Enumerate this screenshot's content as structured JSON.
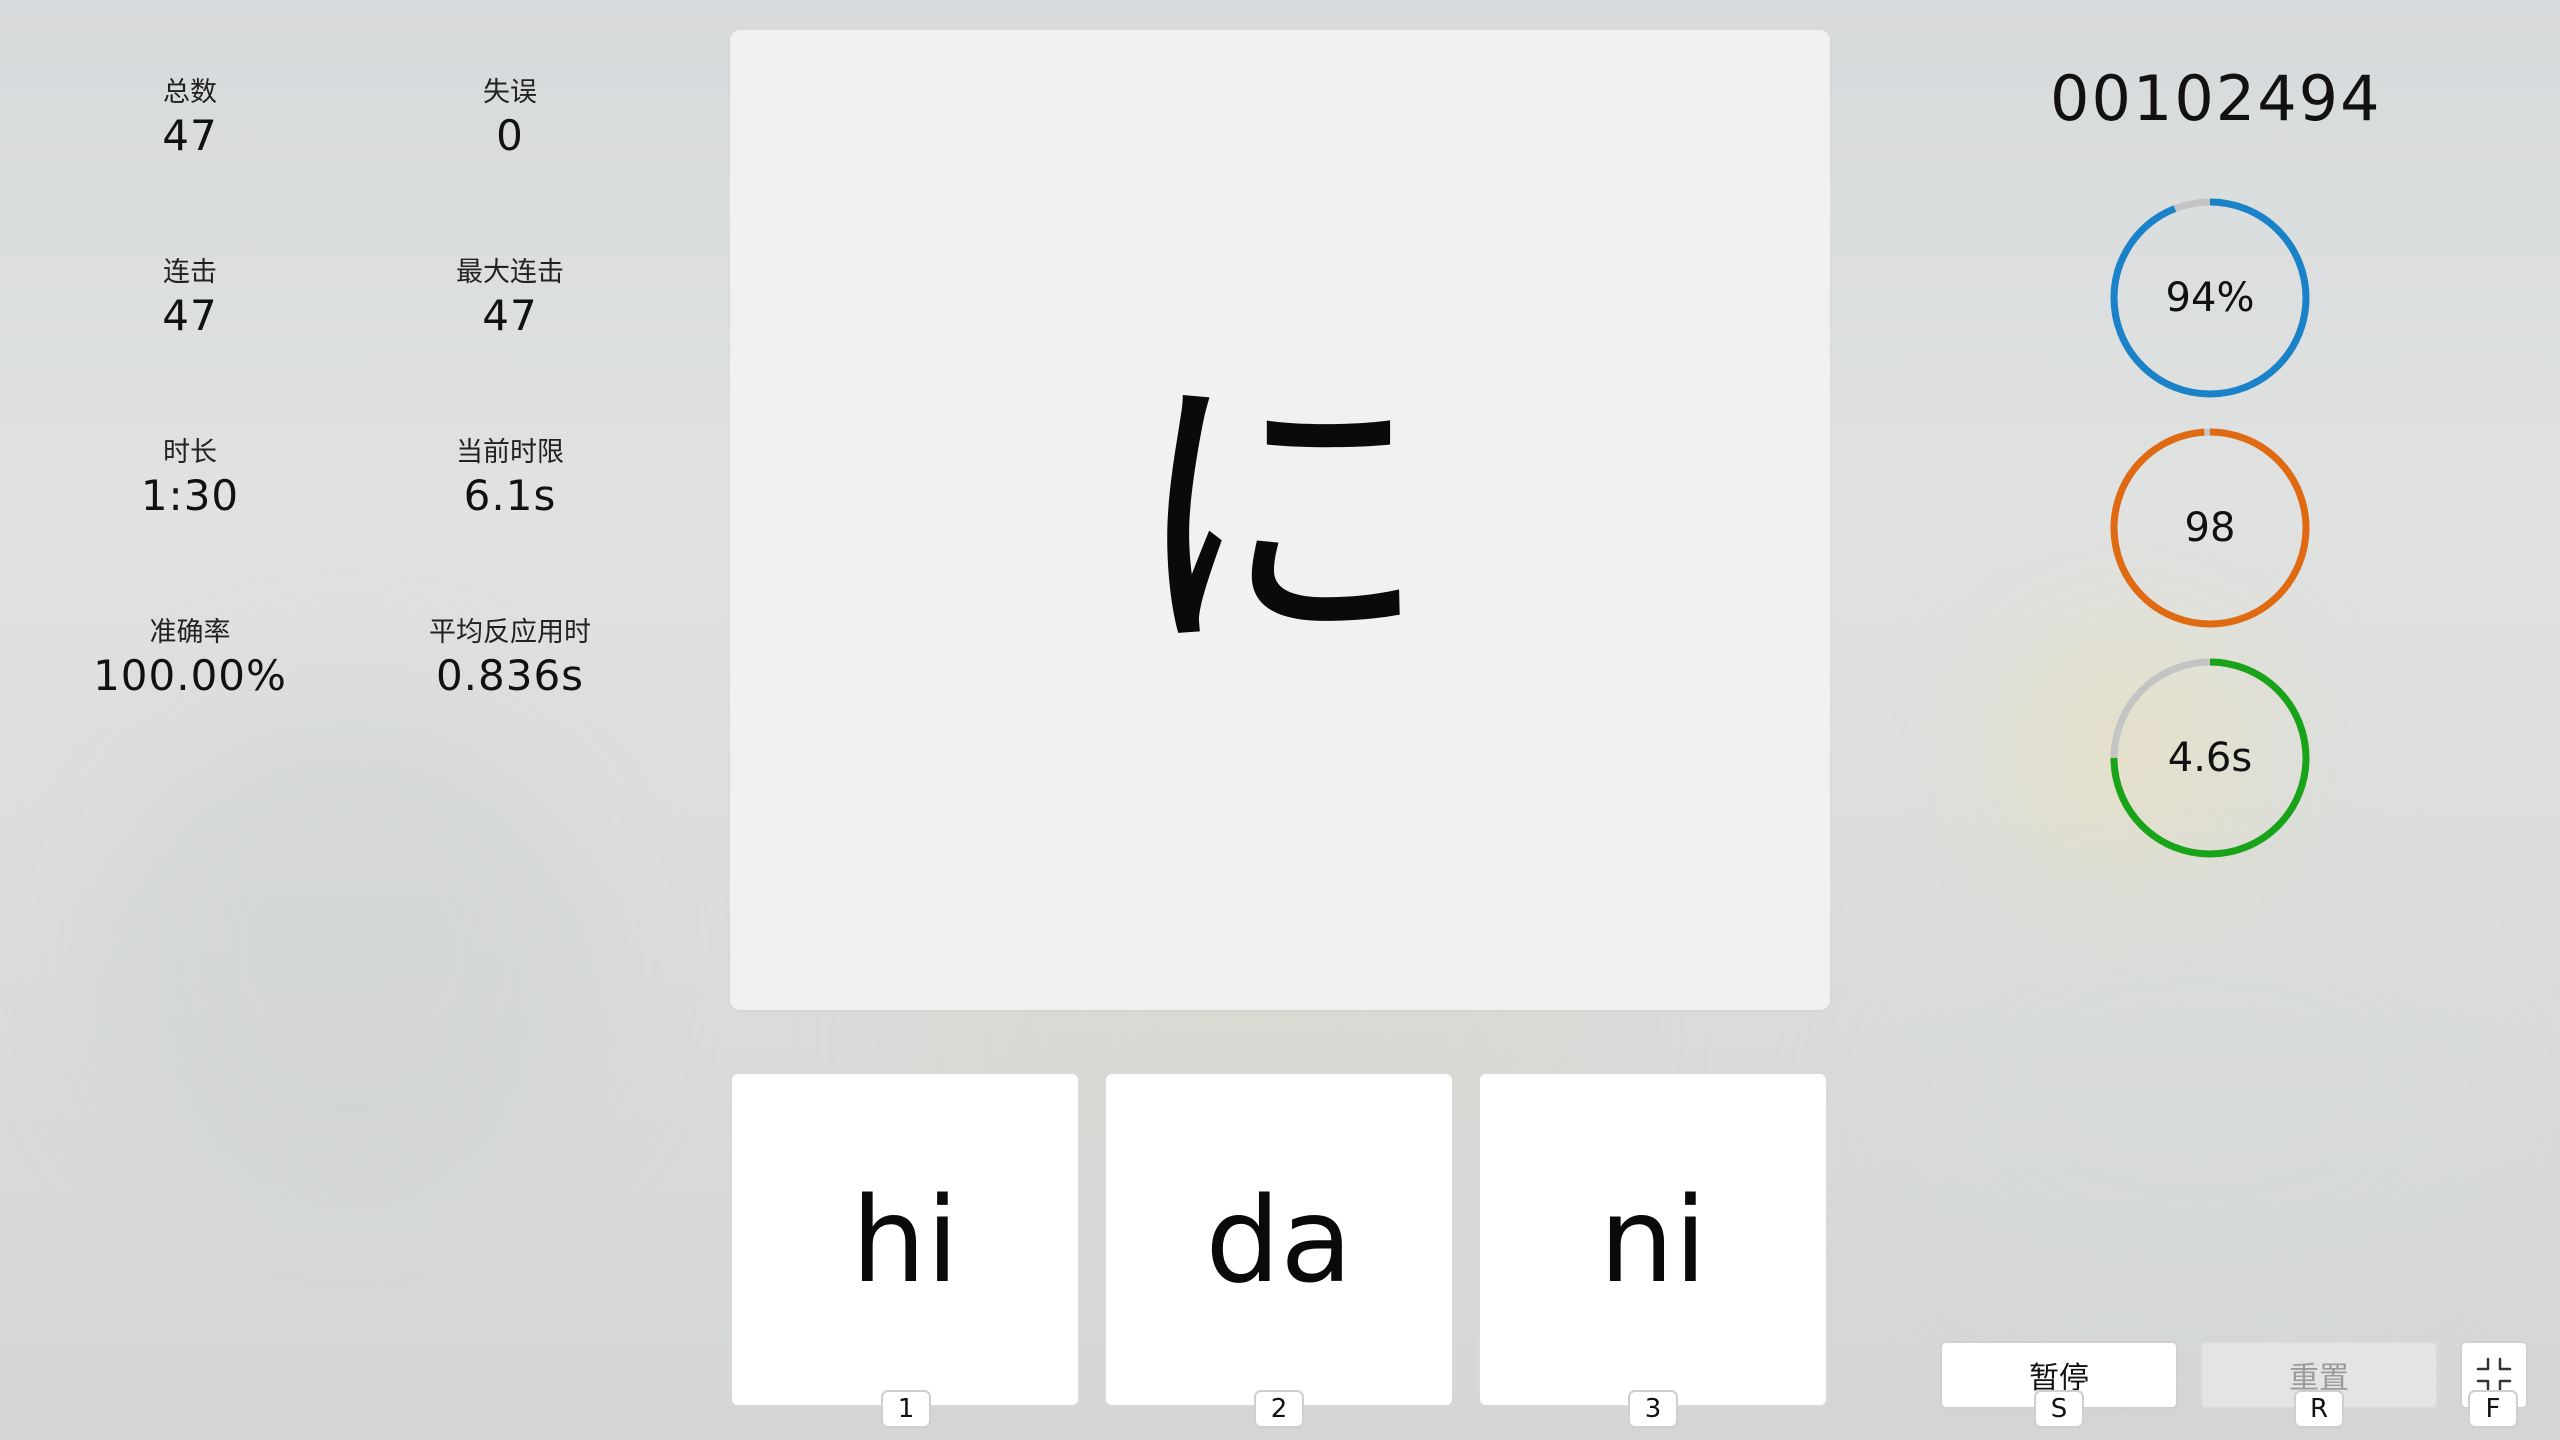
{
  "stats": [
    {
      "label": "总数",
      "value": "47"
    },
    {
      "label": "失误",
      "value": "0"
    },
    {
      "label": "连击",
      "value": "47"
    },
    {
      "label": "最大连击",
      "value": "47"
    },
    {
      "label": "时长",
      "value": "1:30"
    },
    {
      "label": "当前时限",
      "value": "6.1s"
    },
    {
      "label": "准确率",
      "value": "100.00%"
    },
    {
      "label": "平均反应用时",
      "value": "0.836s"
    }
  ],
  "prompt": {
    "character": "に"
  },
  "options": [
    {
      "label": "hi",
      "key": "1"
    },
    {
      "label": "da",
      "key": "2"
    },
    {
      "label": "ni",
      "key": "3"
    }
  ],
  "score": "00102494",
  "rings": [
    {
      "label": "94%",
      "progress": 0.94,
      "color": "#1a82c8"
    },
    {
      "label": "98",
      "progress": 0.99,
      "color": "#e06a12"
    },
    {
      "label": "4.6s",
      "progress": 0.75,
      "color": "#18a318"
    }
  ],
  "ring_track_color": "#c4c4c4",
  "controls": {
    "pause_label": "暂停",
    "pause_key": "S",
    "reset_label": "重置",
    "reset_key": "R",
    "fullscreen_icon": "exit-fullscreen-icon",
    "fullscreen_key": "F"
  }
}
